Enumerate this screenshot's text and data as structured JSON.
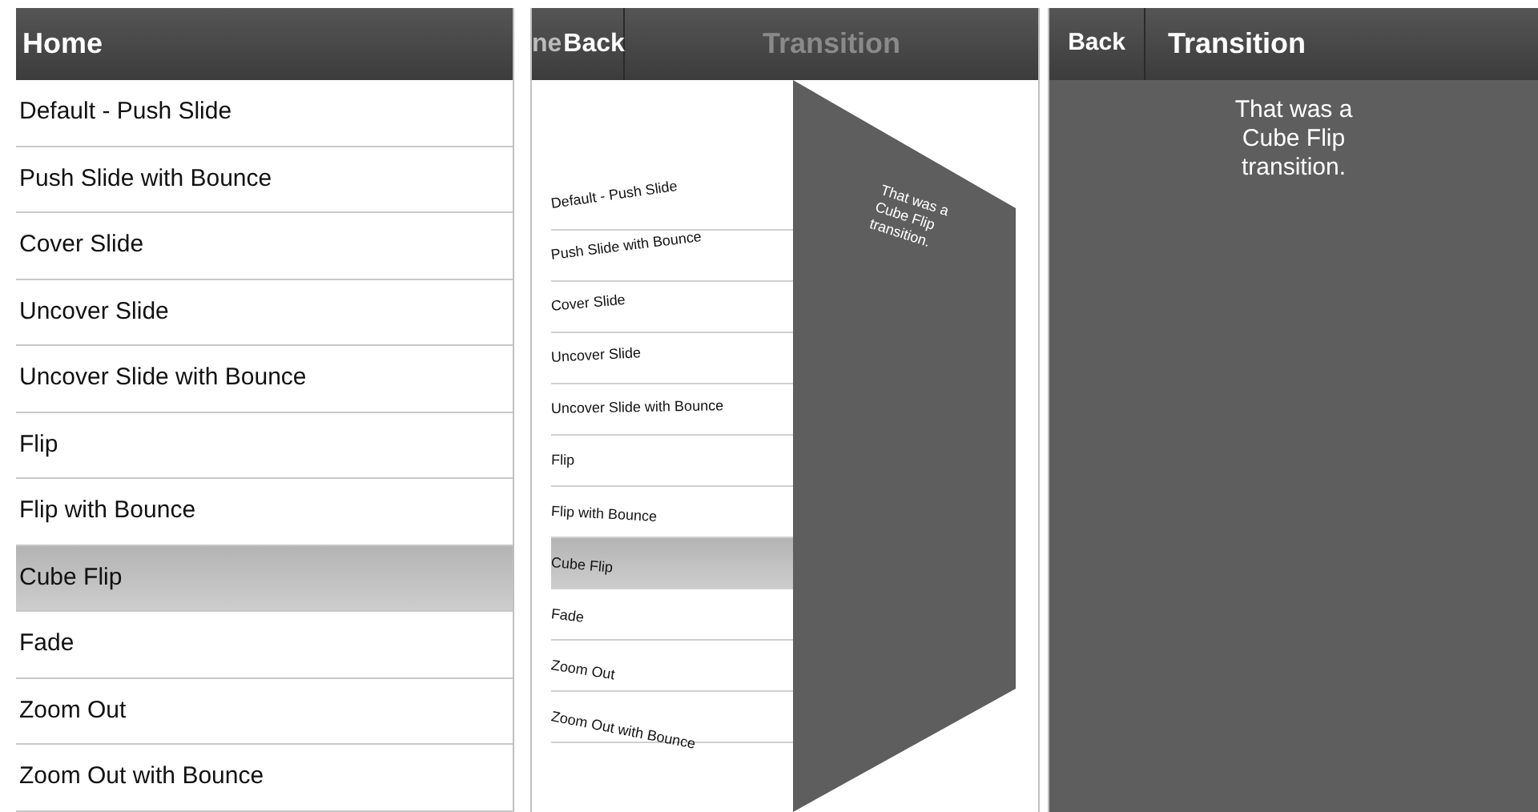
{
  "screens": [
    {
      "kind": "list",
      "title": "Home",
      "items": [
        {
          "label": "Default - Push Slide",
          "selected": false
        },
        {
          "label": "Push Slide with Bounce",
          "selected": false
        },
        {
          "label": "Cover Slide",
          "selected": false
        },
        {
          "label": "Uncover Slide",
          "selected": false
        },
        {
          "label": "Uncover Slide with Bounce",
          "selected": false
        },
        {
          "label": "Flip",
          "selected": false
        },
        {
          "label": "Flip with Bounce",
          "selected": false
        },
        {
          "label": "Cube Flip",
          "selected": true
        },
        {
          "label": "Fade",
          "selected": false
        },
        {
          "label": "Zoom Out",
          "selected": false
        },
        {
          "label": "Zoom Out with Bounce",
          "selected": false
        }
      ]
    },
    {
      "kind": "cube",
      "back_title": "ne",
      "back": "Back",
      "title": "Transition",
      "message": "That was a Cube Flip transition.",
      "items": [
        {
          "label": "Default - Push Slide",
          "selected": false
        },
        {
          "label": "Push Slide with Bounce",
          "selected": false
        },
        {
          "label": "Cover Slide",
          "selected": false
        },
        {
          "label": "Uncover Slide",
          "selected": false
        },
        {
          "label": "Uncover Slide with Bounce",
          "selected": false
        },
        {
          "label": "Flip",
          "selected": false
        },
        {
          "label": "Flip with Bounce",
          "selected": false
        },
        {
          "label": "Cube Flip",
          "selected": true
        },
        {
          "label": "Fade",
          "selected": false
        },
        {
          "label": "Zoom Out",
          "selected": false
        },
        {
          "label": "Zoom Out with Bounce",
          "selected": false
        }
      ]
    },
    {
      "kind": "detail",
      "back": "Back",
      "title": "Transition",
      "message": "That was a Cube Flip transition."
    }
  ]
}
